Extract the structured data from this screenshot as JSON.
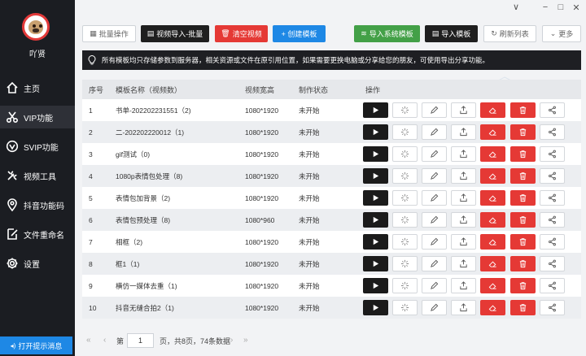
{
  "sidebar": {
    "username": "吖贤",
    "items": [
      {
        "label": "主页",
        "icon": "home-icon"
      },
      {
        "label": "VIP功能",
        "icon": "scissors-icon"
      },
      {
        "label": "SVIP功能",
        "icon": "svip-icon"
      },
      {
        "label": "视频工具",
        "icon": "tools-icon"
      },
      {
        "label": "抖音功能码",
        "icon": "location-pin-icon"
      },
      {
        "label": "文件重命名",
        "icon": "edit-file-icon"
      },
      {
        "label": "设置",
        "icon": "gear-icon"
      }
    ],
    "active_index": 1,
    "tips_button": "打开提示消息"
  },
  "window": {
    "minimize": "−",
    "maximize": "□",
    "close": "✕",
    "collapse": "∨"
  },
  "toolbar": {
    "batch": "批量操作",
    "import_video_batch": "视频导入-批量",
    "clear_video": "清空视频",
    "create_template": "+ 创建模板",
    "import_system_template": "导入系统模板",
    "import_template": "导入模板",
    "refresh_list": "刷新列表",
    "more": "更多"
  },
  "notice": "所有模板均只存储参数到服务器，相关资源或文件在原引用位置，如果需要更换电脑或分享给您的朋友，可使用导出分享功能。",
  "table": {
    "headers": [
      "序号",
      "模板名称（视频数）",
      "视频宽高",
      "制作状态",
      "操作"
    ],
    "rows": [
      {
        "idx": "1",
        "name": "书单-202202231551（2)",
        "size": "1080*1920",
        "status": "未开始"
      },
      {
        "idx": "2",
        "name": "二-202202220012（1)",
        "size": "1080*1920",
        "status": "未开始"
      },
      {
        "idx": "3",
        "name": "gif测试（0)",
        "size": "1080*1920",
        "status": "未开始"
      },
      {
        "idx": "4",
        "name": "1080p表情包处理（8)",
        "size": "1080*1920",
        "status": "未开始"
      },
      {
        "idx": "5",
        "name": "表情包加背景（2)",
        "size": "1080*1920",
        "status": "未开始"
      },
      {
        "idx": "6",
        "name": "表情包预处理（8)",
        "size": "1080*960",
        "status": "未开始"
      },
      {
        "idx": "7",
        "name": "相框（2)",
        "size": "1080*1920",
        "status": "未开始"
      },
      {
        "idx": "8",
        "name": "框1（1)",
        "size": "1080*1920",
        "status": "未开始"
      },
      {
        "idx": "9",
        "name": "横仿一媒体去重（1)",
        "size": "1080*1920",
        "status": "未开始"
      },
      {
        "idx": "10",
        "name": "抖音无缝合拍2（1)",
        "size": "1080*1920",
        "status": "未开始"
      }
    ]
  },
  "pager": {
    "first": "«",
    "prev": "‹",
    "page_label": "第",
    "page_value": "1",
    "total_label": "页，共8页，74条数据",
    "next": "›",
    "last": "»"
  },
  "colors": {
    "accent": "#1e88e5",
    "danger": "#e53935",
    "success": "#43a047",
    "sidebar": "#1b1d22"
  }
}
